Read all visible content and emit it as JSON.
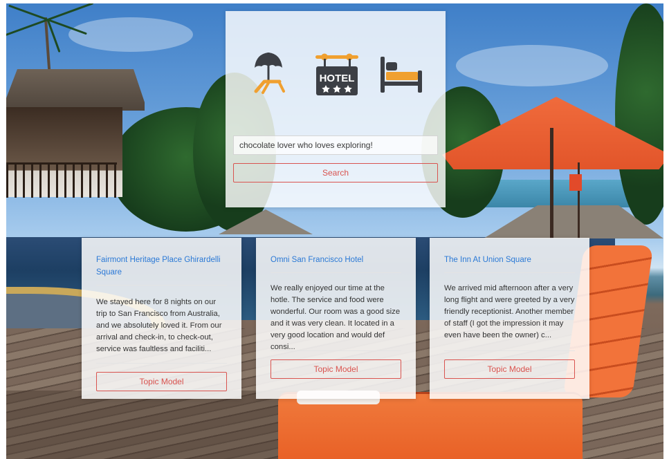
{
  "search": {
    "value": "chocolate lover who loves exploring!",
    "button_label": "Search"
  },
  "icons": {
    "beach": "beach-umbrella-icon",
    "hotel": "hotel-sign-icon",
    "bed": "bed-icon",
    "hotel_sign_text": "HOTEL"
  },
  "colors": {
    "accent_orange": "#f0a030",
    "icon_dark": "#3c3f45",
    "button_red": "#d9534f",
    "link_blue": "#2b79d6"
  },
  "results": [
    {
      "title": "Fairmont Heritage Place Ghirardelli Square",
      "review": "We stayed here for 8 nights on our trip to San Francisco from Australia, and we absolutely loved it. From our arrival and check-in, to check-out, service was faultless and faciliti...",
      "button_label": "Topic Model"
    },
    {
      "title": "Omni San Francisco Hotel",
      "review": "We really enjoyed our time at the hotle. The service and food were wonderful. Our room was a good size and it was very clean. It located in a very good location and would def consi...",
      "button_label": "Topic Model"
    },
    {
      "title": "The Inn At Union Square",
      "review": "We arrived mid afternoon after a very long flight and were greeted by a very friendly receptionist. Another member of staff (I got the impression it may even have been the owner) c...",
      "button_label": "Topic Model"
    }
  ]
}
